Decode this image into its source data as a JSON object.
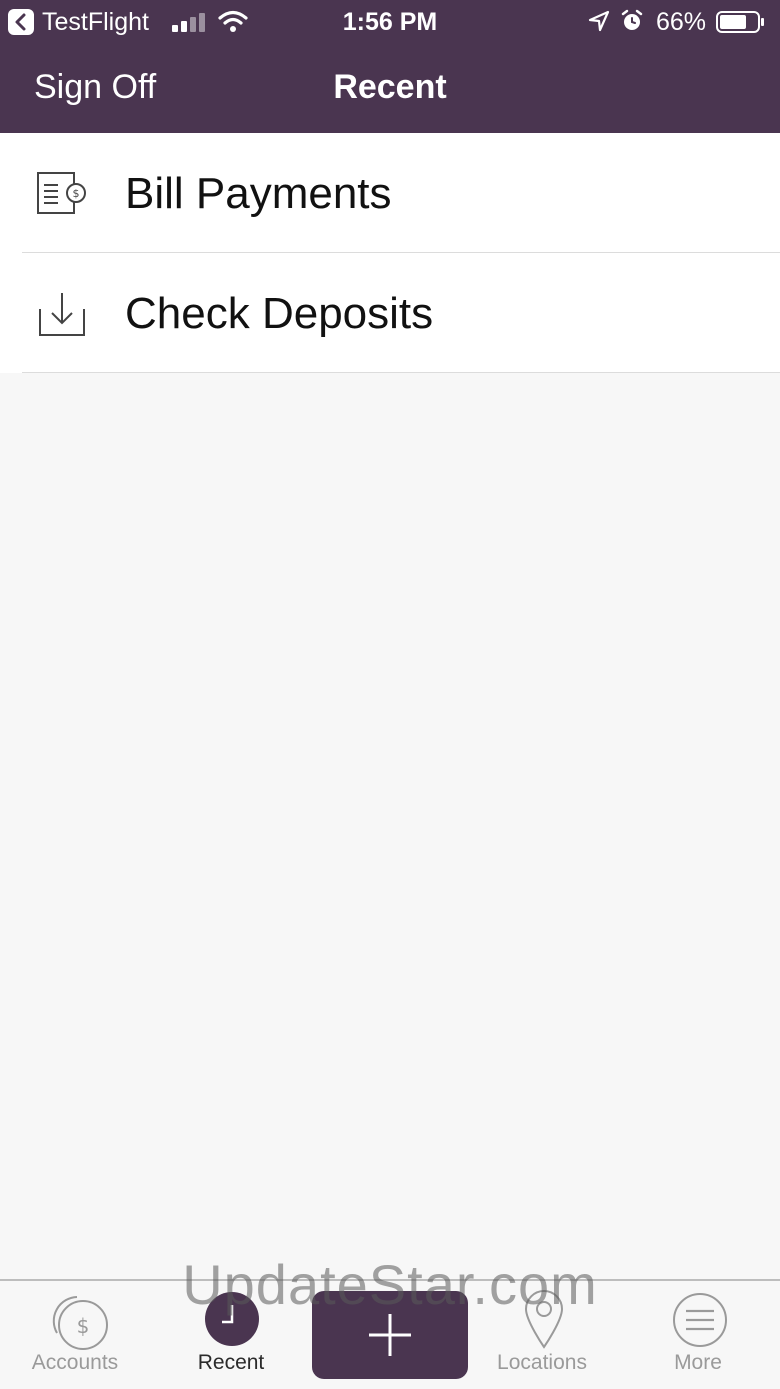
{
  "status_bar": {
    "back_app": "TestFlight",
    "time": "1:56 PM",
    "battery_percent": "66%"
  },
  "nav": {
    "left_button": "Sign Off",
    "title": "Recent"
  },
  "list": {
    "items": [
      {
        "label": "Bill Payments",
        "icon": "bill-payment-icon"
      },
      {
        "label": "Check Deposits",
        "icon": "deposit-download-icon"
      }
    ]
  },
  "tabbar": {
    "tabs": [
      {
        "label": "Accounts",
        "icon": "accounts-dollar-icon",
        "active": false
      },
      {
        "label": "Recent",
        "icon": "clock-icon",
        "active": true
      },
      {
        "label": "Locations",
        "icon": "location-pin-icon",
        "active": false
      },
      {
        "label": "More",
        "icon": "menu-icon",
        "active": false
      }
    ],
    "add_button_icon": "plus-icon"
  },
  "watermark": "UpdateStar.com",
  "colors": {
    "brand": "#4a3550",
    "background": "#f7f7f7",
    "tab_inactive": "#9a9a9a"
  }
}
